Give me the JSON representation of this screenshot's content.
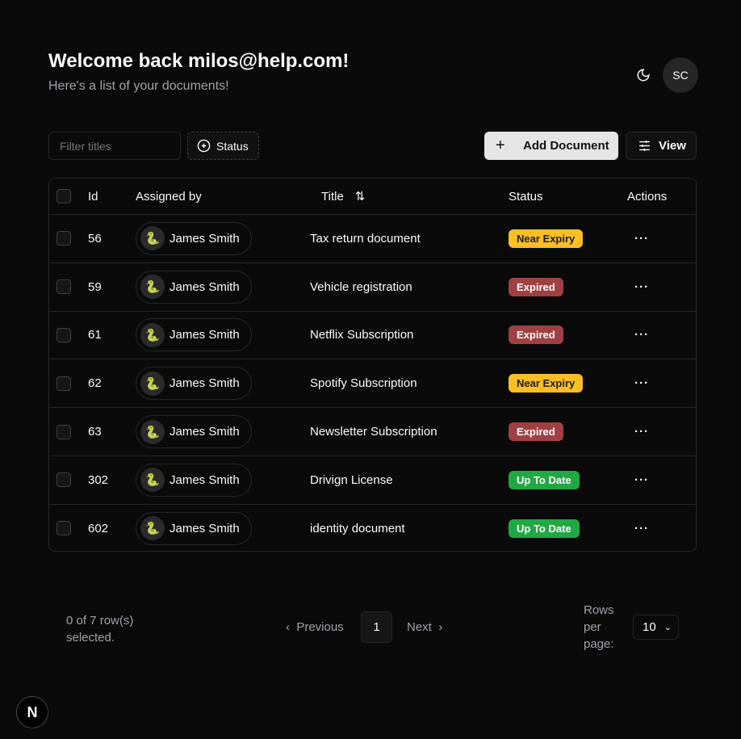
{
  "header": {
    "title": "Welcome back milos@help.com!",
    "subtitle": "Here's a list of your documents!",
    "theme_icon": "moon-icon",
    "avatar_initials": "SC"
  },
  "toolbar": {
    "filter_placeholder": "Filter titles",
    "status_label": "Status",
    "add_label": "Add Document",
    "view_label": "View"
  },
  "table": {
    "columns": {
      "id": "Id",
      "assigned": "Assigned by",
      "title": "Title",
      "status": "Status",
      "actions": "Actions"
    },
    "status_colors": {
      "Near Expiry": "#fbbf24",
      "Expired": "#9f4143",
      "Up To Date": "#22a745"
    },
    "rows": [
      {
        "id": "56",
        "assigned": "James Smith",
        "title": "Tax return document",
        "status": "Near Expiry"
      },
      {
        "id": "59",
        "assigned": "James Smith",
        "title": "Vehicle registration",
        "status": "Expired"
      },
      {
        "id": "61",
        "assigned": "James Smith",
        "title": "Netflix Subscription",
        "status": "Expired"
      },
      {
        "id": "62",
        "assigned": "James Smith",
        "title": "Spotify Subscription",
        "status": "Near Expiry"
      },
      {
        "id": "63",
        "assigned": "James Smith",
        "title": "Newsletter Subscription",
        "status": "Expired"
      },
      {
        "id": "302",
        "assigned": "James Smith",
        "title": "Drivign License",
        "status": "Up To Date"
      },
      {
        "id": "602",
        "assigned": "James Smith",
        "title": "identity document",
        "status": "Up To Date"
      }
    ]
  },
  "footer": {
    "selection": "0 of 7 row(s) selected.",
    "previous": "Previous",
    "page": "1",
    "next": "Next",
    "rows_per_page_label": "Rows per page:",
    "rows_per_page": "10"
  },
  "badge": {
    "logo": "N"
  }
}
